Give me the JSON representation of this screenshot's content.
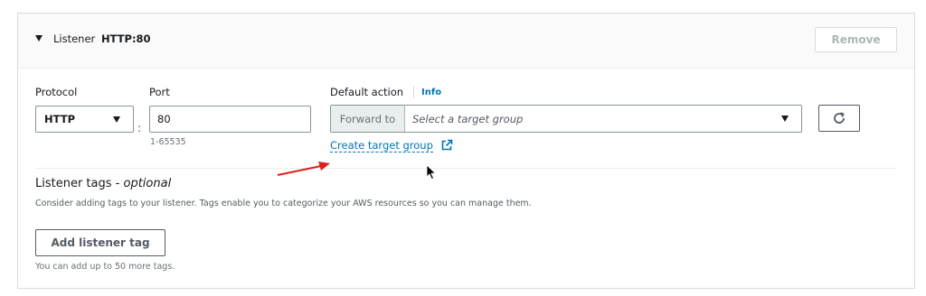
{
  "header": {
    "listener_label": "Listener",
    "listener_value": "HTTP:80",
    "remove_label": "Remove"
  },
  "protocol": {
    "label": "Protocol",
    "selected": "HTTP"
  },
  "port": {
    "label": "Port",
    "value": "80",
    "hint": "1-65535",
    "separator": ":"
  },
  "default_action": {
    "label": "Default action",
    "info_label": "Info",
    "forward_label": "Forward to",
    "target_placeholder": "Select a target group",
    "create_link": "Create target group"
  },
  "tags": {
    "title": "Listener tags -",
    "title_optional": "optional",
    "description": "Consider adding tags to your listener. Tags enable you to categorize your AWS resources so you can manage them.",
    "add_button": "Add listener tag",
    "limit_text": "You can add up to 50 more tags."
  },
  "icons": {
    "header_caret": "caret-down-icon",
    "protocol_caret": "caret-down-icon",
    "target_caret": "caret-down-icon",
    "refresh": "refresh-icon",
    "external_link": "external-link-icon",
    "annotation_arrow": "red-arrow-icon",
    "cursor": "mouse-pointer-icon"
  },
  "colors": {
    "link": "#0073bb",
    "annotation": "#e02020",
    "border": "#879596",
    "header_bg": "#fafafa"
  }
}
